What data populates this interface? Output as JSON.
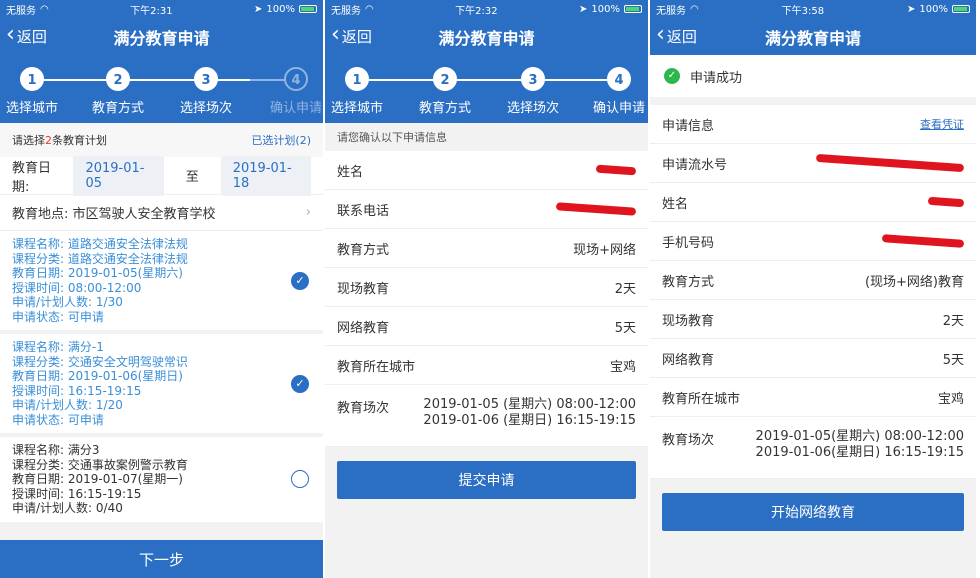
{
  "status": {
    "carrier": "无服务",
    "battery": "100%",
    "screen1_time": "下午2:31",
    "screen2_time": "下午2:32",
    "screen3_time": "下午3:58"
  },
  "nav": {
    "back_label": "返回",
    "title": "满分教育申请"
  },
  "steps": [
    {
      "num": "1",
      "label": "选择城市"
    },
    {
      "num": "2",
      "label": "教育方式"
    },
    {
      "num": "3",
      "label": "选择场次"
    },
    {
      "num": "4",
      "label": "确认申请"
    }
  ],
  "screen1": {
    "plan_prefix": "请选择",
    "plan_count": "2",
    "plan_suffix": "条教育计划",
    "selected_link": "已选计划(2)",
    "date_label": "教育日期:",
    "date_from": "2019-01-05",
    "date_to_word": "至",
    "date_to": "2019-01-18",
    "location_label": "教育地点:",
    "location_value": "市区驾驶人安全教育学校",
    "courses": [
      {
        "name": "课程名称: 道路交通安全法律法规",
        "category": "课程分类: 道路交通安全法律法规",
        "date": "教育日期: 2019-01-05(星期六)",
        "time": "授课时间: 08:00-12:00",
        "count": "申请/计划人数: 1/30",
        "state": "申请状态: 可申请",
        "checked": true
      },
      {
        "name": "课程名称: 满分-1",
        "category": "课程分类: 交通安全文明驾驶常识",
        "date": "教育日期: 2019-01-06(星期日)",
        "time": "授课时间: 16:15-19:15",
        "count": "申请/计划人数: 1/20",
        "state": "申请状态: 可申请",
        "checked": true
      },
      {
        "name": "课程名称: 满分3",
        "category": "课程分类: 交通事故案例警示教育",
        "date": "教育日期: 2019-01-07(星期一)",
        "time": "授课时间: 16:15-19:15",
        "count": "申请/计划人数: 0/40",
        "checked": false
      }
    ],
    "next_button": "下一步"
  },
  "screen2": {
    "hint": "请您确认以下申请信息",
    "rows": [
      {
        "label": "姓名",
        "value": ""
      },
      {
        "label": "联系电话",
        "value": ""
      },
      {
        "label": "教育方式",
        "value": "现场+网络"
      },
      {
        "label": "现场教育",
        "value": "2天"
      },
      {
        "label": "网络教育",
        "value": "5天"
      },
      {
        "label": "教育所在城市",
        "value": "宝鸡"
      }
    ],
    "session_label": "教育场次",
    "session_1": "2019-01-05 (星期六) 08:00-12:00",
    "session_2": "2019-01-06 (星期日) 16:15-19:15",
    "submit_button": "提交申请"
  },
  "screen3": {
    "success_text": "申请成功",
    "info_label": "申请信息",
    "voucher_link": "查看凭证",
    "rows": [
      {
        "label": "申请流水号",
        "value": ""
      },
      {
        "label": "姓名",
        "value": ""
      },
      {
        "label": "手机号码",
        "value": ""
      },
      {
        "label": "教育方式",
        "value": "(现场+网络)教育"
      },
      {
        "label": "现场教育",
        "value": "2天"
      },
      {
        "label": "网络教育",
        "value": "5天"
      },
      {
        "label": "教育所在城市",
        "value": "宝鸡"
      }
    ],
    "session_label": "教育场次",
    "session_1": "2019-01-05(星期六) 08:00-12:00",
    "session_2": "2019-01-06(星期日) 16:15-19:15",
    "start_button": "开始网络教育"
  },
  "colors": {
    "primary": "#2b6fc4",
    "redact": "#e0141e",
    "success": "#2db84d"
  }
}
